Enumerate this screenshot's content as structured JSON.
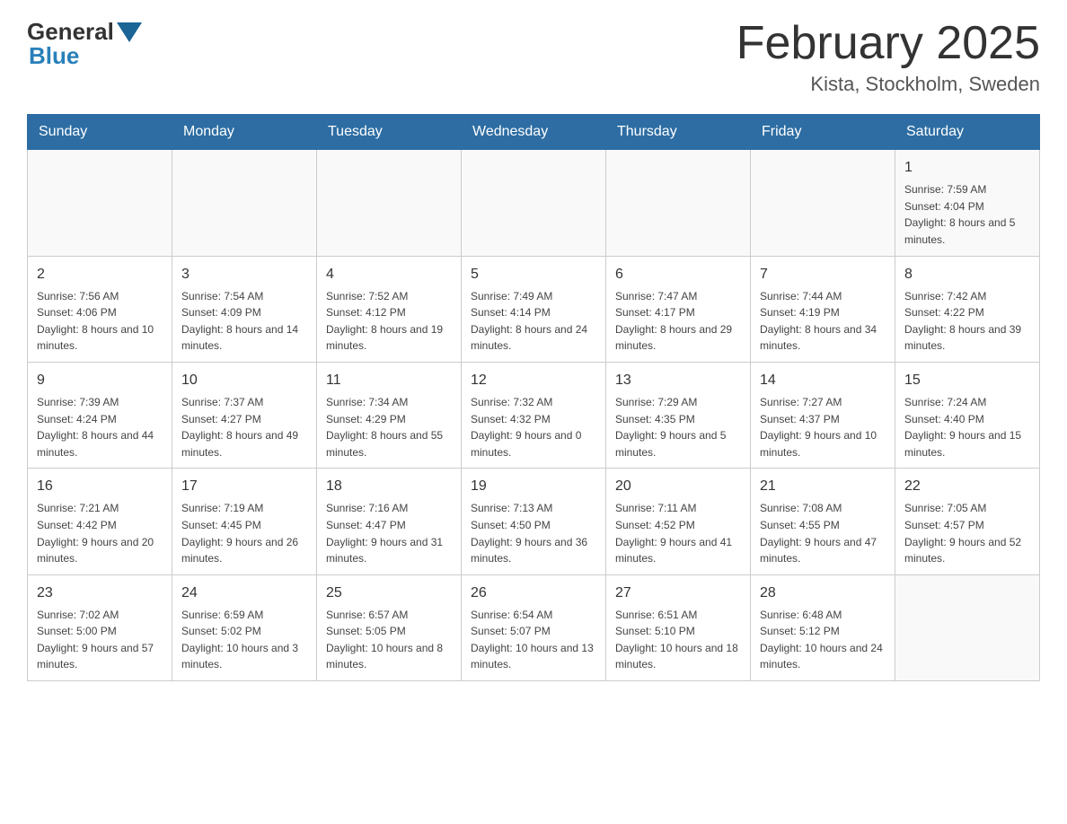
{
  "header": {
    "logo": {
      "general": "General",
      "blue": "Blue"
    },
    "title": "February 2025",
    "location": "Kista, Stockholm, Sweden"
  },
  "days_of_week": [
    "Sunday",
    "Monday",
    "Tuesday",
    "Wednesday",
    "Thursday",
    "Friday",
    "Saturday"
  ],
  "weeks": [
    [
      null,
      null,
      null,
      null,
      null,
      null,
      {
        "day": "1",
        "sunrise": "7:59 AM",
        "sunset": "4:04 PM",
        "daylight": "8 hours and 5 minutes."
      }
    ],
    [
      {
        "day": "2",
        "sunrise": "7:56 AM",
        "sunset": "4:06 PM",
        "daylight": "8 hours and 10 minutes."
      },
      {
        "day": "3",
        "sunrise": "7:54 AM",
        "sunset": "4:09 PM",
        "daylight": "8 hours and 14 minutes."
      },
      {
        "day": "4",
        "sunrise": "7:52 AM",
        "sunset": "4:12 PM",
        "daylight": "8 hours and 19 minutes."
      },
      {
        "day": "5",
        "sunrise": "7:49 AM",
        "sunset": "4:14 PM",
        "daylight": "8 hours and 24 minutes."
      },
      {
        "day": "6",
        "sunrise": "7:47 AM",
        "sunset": "4:17 PM",
        "daylight": "8 hours and 29 minutes."
      },
      {
        "day": "7",
        "sunrise": "7:44 AM",
        "sunset": "4:19 PM",
        "daylight": "8 hours and 34 minutes."
      },
      {
        "day": "8",
        "sunrise": "7:42 AM",
        "sunset": "4:22 PM",
        "daylight": "8 hours and 39 minutes."
      }
    ],
    [
      {
        "day": "9",
        "sunrise": "7:39 AM",
        "sunset": "4:24 PM",
        "daylight": "8 hours and 44 minutes."
      },
      {
        "day": "10",
        "sunrise": "7:37 AM",
        "sunset": "4:27 PM",
        "daylight": "8 hours and 49 minutes."
      },
      {
        "day": "11",
        "sunrise": "7:34 AM",
        "sunset": "4:29 PM",
        "daylight": "8 hours and 55 minutes."
      },
      {
        "day": "12",
        "sunrise": "7:32 AM",
        "sunset": "4:32 PM",
        "daylight": "9 hours and 0 minutes."
      },
      {
        "day": "13",
        "sunrise": "7:29 AM",
        "sunset": "4:35 PM",
        "daylight": "9 hours and 5 minutes."
      },
      {
        "day": "14",
        "sunrise": "7:27 AM",
        "sunset": "4:37 PM",
        "daylight": "9 hours and 10 minutes."
      },
      {
        "day": "15",
        "sunrise": "7:24 AM",
        "sunset": "4:40 PM",
        "daylight": "9 hours and 15 minutes."
      }
    ],
    [
      {
        "day": "16",
        "sunrise": "7:21 AM",
        "sunset": "4:42 PM",
        "daylight": "9 hours and 20 minutes."
      },
      {
        "day": "17",
        "sunrise": "7:19 AM",
        "sunset": "4:45 PM",
        "daylight": "9 hours and 26 minutes."
      },
      {
        "day": "18",
        "sunrise": "7:16 AM",
        "sunset": "4:47 PM",
        "daylight": "9 hours and 31 minutes."
      },
      {
        "day": "19",
        "sunrise": "7:13 AM",
        "sunset": "4:50 PM",
        "daylight": "9 hours and 36 minutes."
      },
      {
        "day": "20",
        "sunrise": "7:11 AM",
        "sunset": "4:52 PM",
        "daylight": "9 hours and 41 minutes."
      },
      {
        "day": "21",
        "sunrise": "7:08 AM",
        "sunset": "4:55 PM",
        "daylight": "9 hours and 47 minutes."
      },
      {
        "day": "22",
        "sunrise": "7:05 AM",
        "sunset": "4:57 PM",
        "daylight": "9 hours and 52 minutes."
      }
    ],
    [
      {
        "day": "23",
        "sunrise": "7:02 AM",
        "sunset": "5:00 PM",
        "daylight": "9 hours and 57 minutes."
      },
      {
        "day": "24",
        "sunrise": "6:59 AM",
        "sunset": "5:02 PM",
        "daylight": "10 hours and 3 minutes."
      },
      {
        "day": "25",
        "sunrise": "6:57 AM",
        "sunset": "5:05 PM",
        "daylight": "10 hours and 8 minutes."
      },
      {
        "day": "26",
        "sunrise": "6:54 AM",
        "sunset": "5:07 PM",
        "daylight": "10 hours and 13 minutes."
      },
      {
        "day": "27",
        "sunrise": "6:51 AM",
        "sunset": "5:10 PM",
        "daylight": "10 hours and 18 minutes."
      },
      {
        "day": "28",
        "sunrise": "6:48 AM",
        "sunset": "5:12 PM",
        "daylight": "10 hours and 24 minutes."
      },
      null
    ]
  ]
}
